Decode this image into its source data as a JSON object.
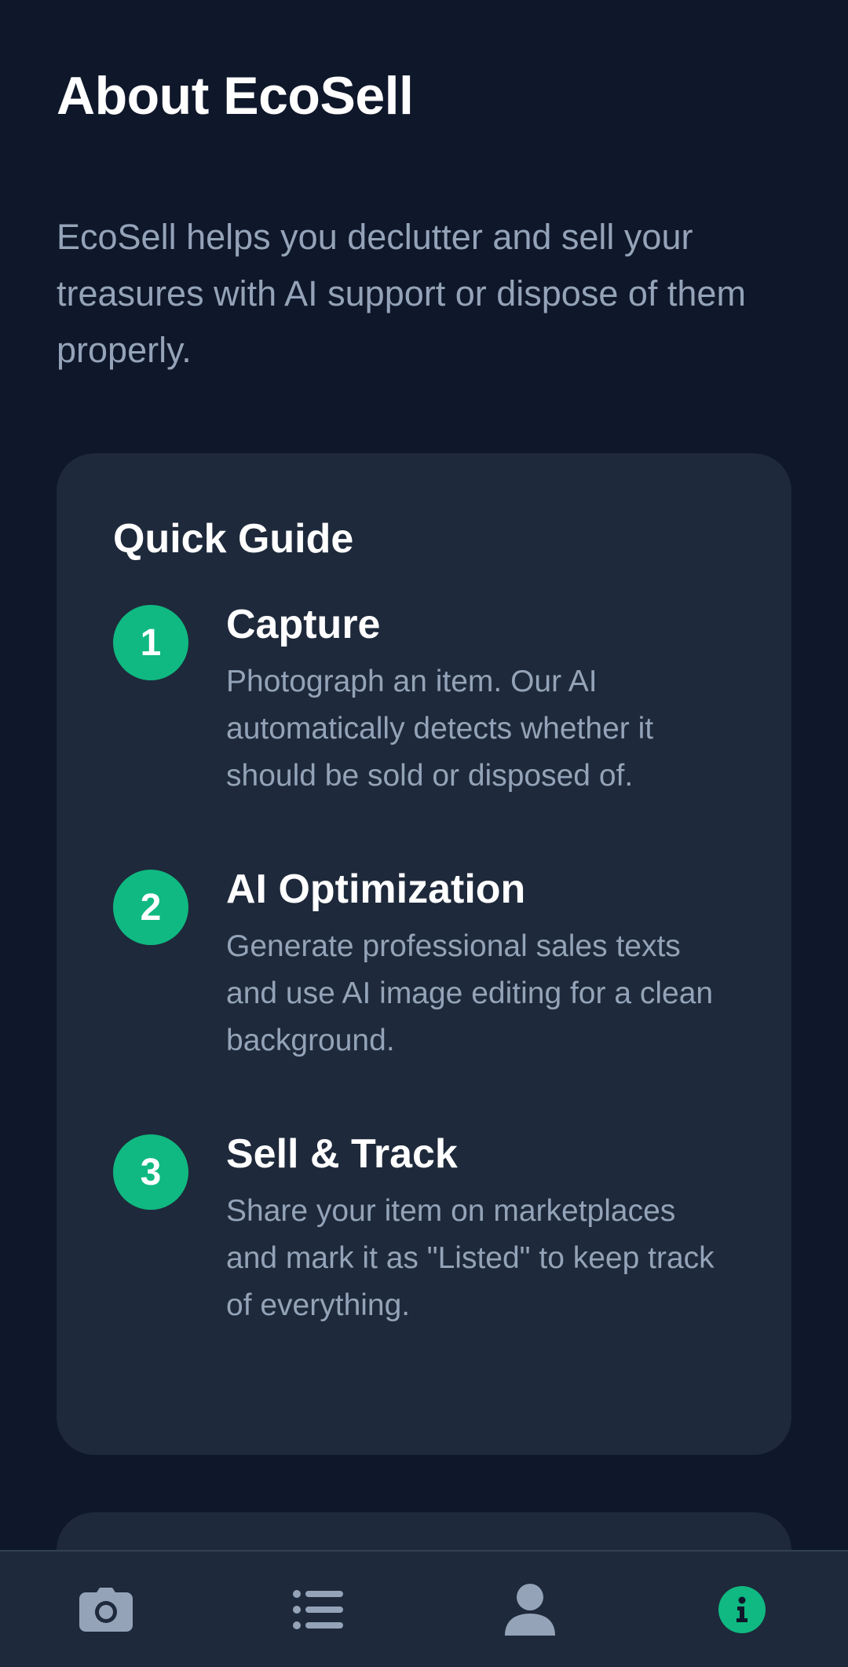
{
  "header": {
    "title": "About EcoSell"
  },
  "intro": {
    "text": "EcoSell helps you declutter and sell your treasures with AI support or dispose of them properly."
  },
  "quick_guide": {
    "title": "Quick Guide",
    "steps": [
      {
        "number": "1",
        "title": "Capture",
        "description": "Photograph an item. Our AI automatically detects whether it should be sold or disposed of."
      },
      {
        "number": "2",
        "title": "AI Optimization",
        "description": "Generate professional sales texts and use AI image editing for a clean background."
      },
      {
        "number": "3",
        "title": "Sell & Track",
        "description": "Share your item on marketplaces and mark it as \"Listed\" to keep track of everything."
      }
    ]
  },
  "bottom_nav": {
    "items": [
      {
        "icon": "camera-icon",
        "active": false
      },
      {
        "icon": "list-icon",
        "active": false
      },
      {
        "icon": "user-icon",
        "active": false
      },
      {
        "icon": "info-icon",
        "active": true
      }
    ]
  },
  "colors": {
    "background": "#0f172a",
    "card": "#1e293b",
    "accent": "#10b981",
    "muted_text": "#94a3b8",
    "icon_inactive": "#94a3b8"
  }
}
